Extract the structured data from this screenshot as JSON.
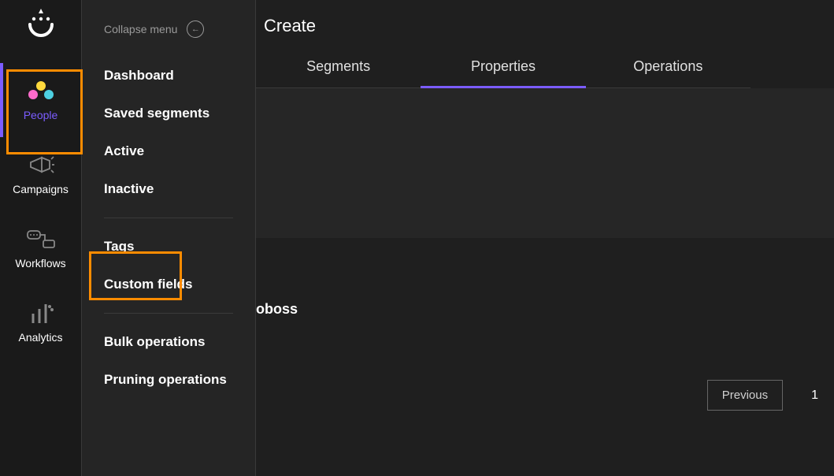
{
  "sidebar_narrow": {
    "items": [
      {
        "label": "People"
      },
      {
        "label": "Campaigns"
      },
      {
        "label": "Workflows"
      },
      {
        "label": "Analytics"
      }
    ]
  },
  "sidebar_wide": {
    "collapse_label": "Collapse menu",
    "items": [
      {
        "label": "Dashboard"
      },
      {
        "label": "Saved segments"
      },
      {
        "label": "Active"
      },
      {
        "label": "Inactive"
      },
      {
        "label": "Tags"
      },
      {
        "label": "Custom fields"
      },
      {
        "label": "Bulk operations"
      },
      {
        "label": "Pruning operations"
      }
    ]
  },
  "main": {
    "breadcrumb_tail": "Create",
    "tabs": [
      {
        "label": "Segments"
      },
      {
        "label": "Properties"
      },
      {
        "label": "Operations"
      }
    ],
    "partial_text": "oboss",
    "pagination": {
      "previous": "Previous",
      "page": "1"
    }
  }
}
